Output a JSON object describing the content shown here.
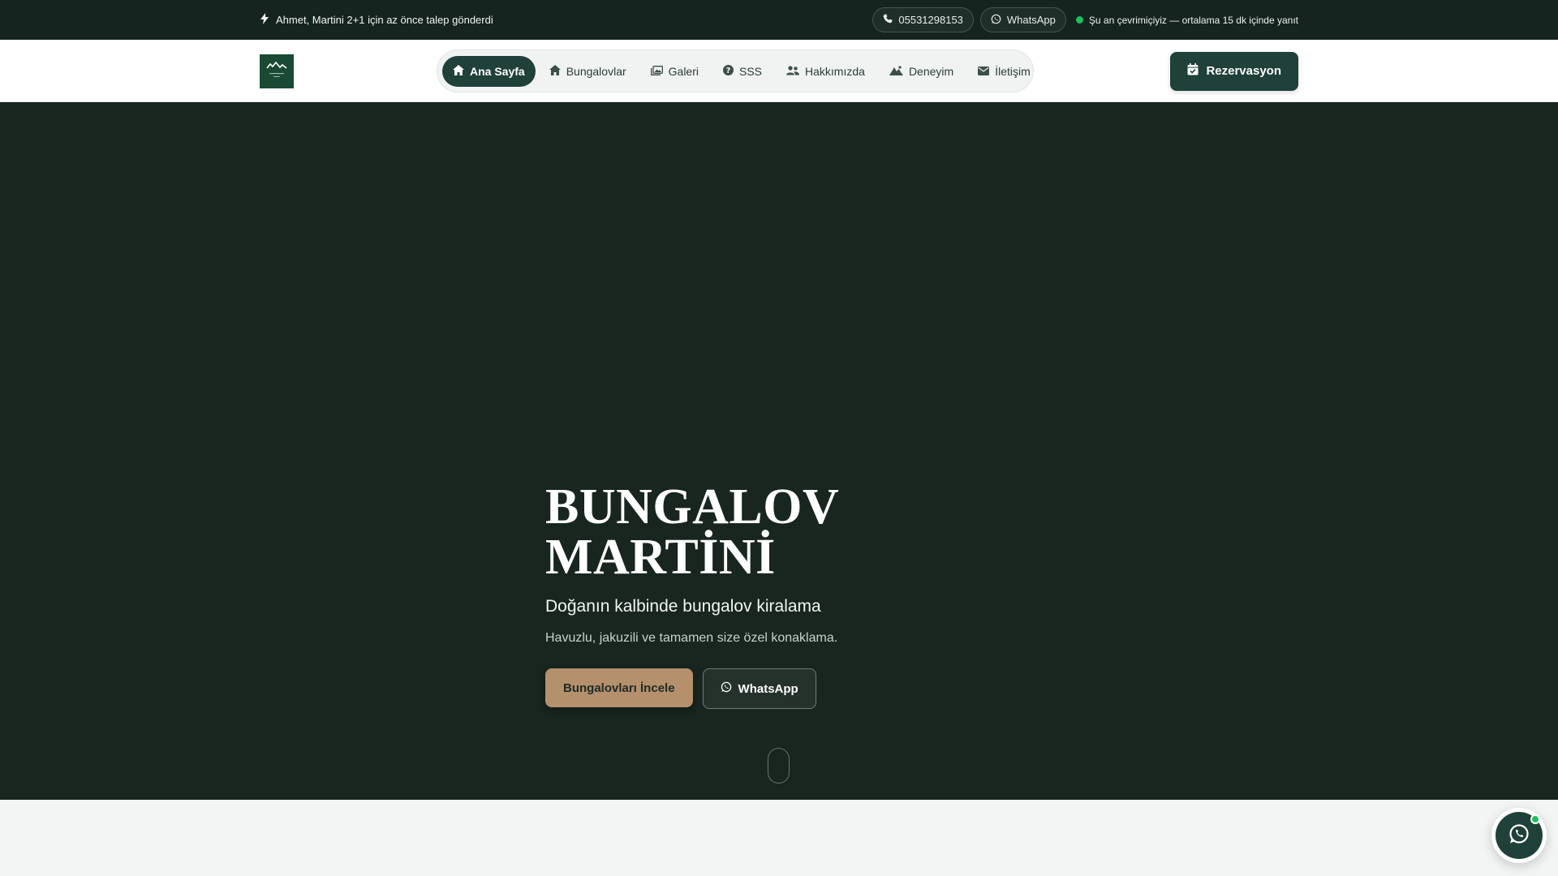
{
  "topbar": {
    "announcement": "Ahmet, Martini 2+1 için az önce talep gönderdi",
    "phone": "05531298153",
    "whatsapp": "WhatsApp",
    "online_status": "Şu an çevrimiçiyiz — ortalama 15 dk içinde yanıt"
  },
  "header": {
    "nav": [
      {
        "label": "Ana Sayfa",
        "icon": "home-icon",
        "active": true
      },
      {
        "label": "Bungalovlar",
        "icon": "house-icon",
        "active": false
      },
      {
        "label": "Galeri",
        "icon": "gallery-icon",
        "active": false
      },
      {
        "label": "SSS",
        "icon": "question-icon",
        "active": false
      },
      {
        "label": "Hakkımızda",
        "icon": "users-icon",
        "active": false
      },
      {
        "label": "Deneyim",
        "icon": "mountain-icon",
        "active": false
      },
      {
        "label": "İletişim",
        "icon": "mail-icon",
        "active": false
      }
    ],
    "reserve_label": "Rezervasyon"
  },
  "hero": {
    "title_line1": "BUNGALOV",
    "title_line2": "MARTİNİ",
    "subtitle": "Doğanın kalbinde bungalov kiralama",
    "description": "Havuzlu, jakuzili ve tamamen size özel konaklama.",
    "primary_button": "Bungalovları İncele",
    "secondary_button": "WhatsApp"
  },
  "colors": {
    "dark_green": "#20403a",
    "hero_bg": "#18261f",
    "accent_gold": "#b4906c",
    "online_green": "#1fbf5c"
  }
}
